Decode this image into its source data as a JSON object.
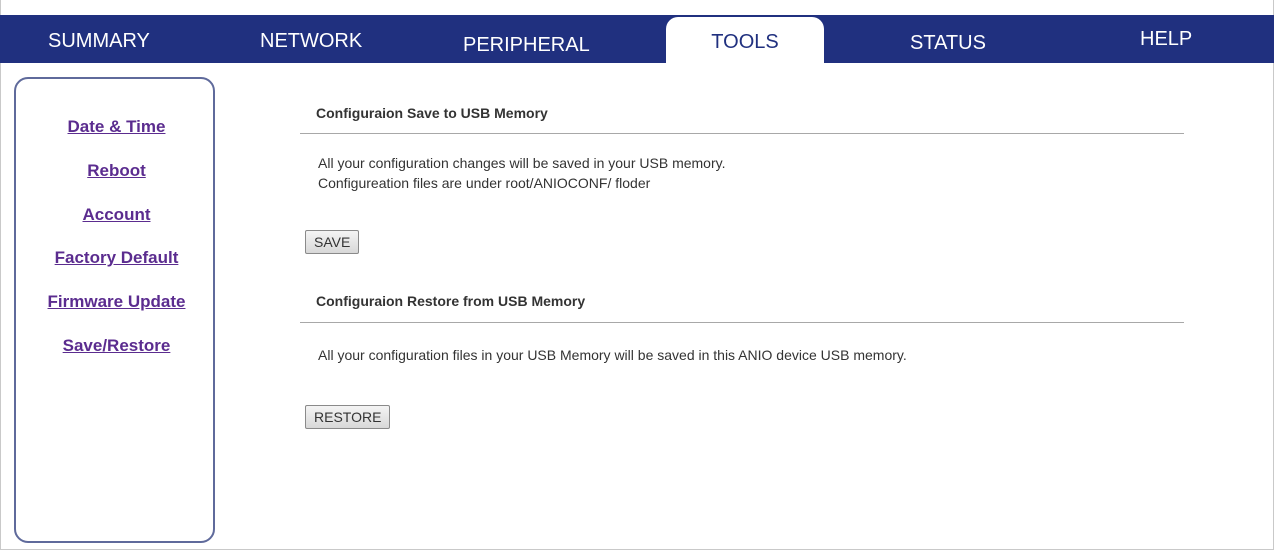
{
  "nav": {
    "tabs": [
      {
        "label": "SUMMARY"
      },
      {
        "label": "NETWORK"
      },
      {
        "label": "PERIPHERAL"
      },
      {
        "label": "TOOLS",
        "active": true
      },
      {
        "label": "STATUS"
      },
      {
        "label": "HELP"
      }
    ]
  },
  "sidebar": {
    "items": [
      {
        "label": "Date & Time"
      },
      {
        "label": "Reboot"
      },
      {
        "label": "Account"
      },
      {
        "label": "Factory Default"
      },
      {
        "label": "Firmware Update"
      },
      {
        "label": "Save/Restore"
      }
    ]
  },
  "save_section": {
    "title": "Configuraion Save to USB Memory",
    "line1": "All your configuration changes will be saved in your USB memory.",
    "line2": "Configureation files are under root/ANIOCONF/ floder",
    "button": "SAVE"
  },
  "restore_section": {
    "title": "Configuraion Restore from USB Memory",
    "line1": "All your configuration files in your USB Memory will be saved in this ANIO device USB memory.",
    "button": "RESTORE"
  },
  "colors": {
    "nav_bg": "#20307f",
    "link": "#5b2c8f",
    "sidebar_border": "#5f6a9b"
  }
}
